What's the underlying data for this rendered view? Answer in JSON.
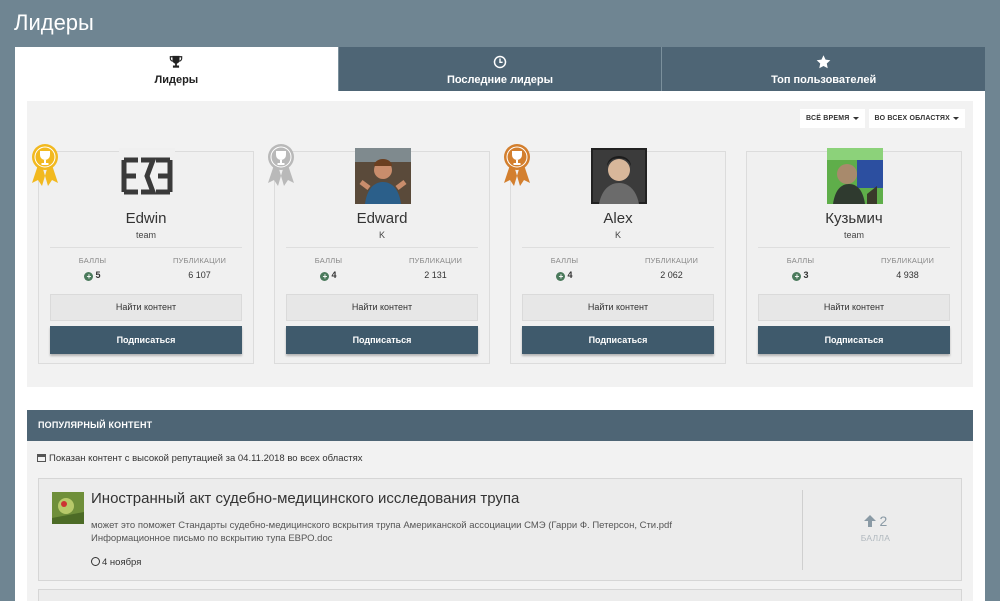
{
  "page_title": "Лидеры",
  "tabs": [
    {
      "label": "Лидеры",
      "icon": "trophy-icon",
      "active": true
    },
    {
      "label": "Последние лидеры",
      "icon": "clock-icon",
      "active": false
    },
    {
      "label": "Топ пользователей",
      "icon": "star-icon",
      "active": false
    }
  ],
  "filters": {
    "time": "ВСЁ ВРЕМЯ",
    "areas": "ВО ВСЕХ ОБЛАСТЯХ"
  },
  "leaders": [
    {
      "name": "Edwin",
      "group": "team",
      "points_label": "БАЛЛЫ",
      "points": "5",
      "posts_label": "ПУБЛИКАЦИИ",
      "posts": "6 107",
      "find_label": "Найти контент",
      "follow_label": "Подписаться",
      "rank": "gold"
    },
    {
      "name": "Edward",
      "group": "K",
      "points_label": "БАЛЛЫ",
      "points": "4",
      "posts_label": "ПУБЛИКАЦИИ",
      "posts": "2 131",
      "find_label": "Найти контент",
      "follow_label": "Подписаться",
      "rank": "silver"
    },
    {
      "name": "Alex",
      "group": "K",
      "points_label": "БАЛЛЫ",
      "points": "4",
      "posts_label": "ПУБЛИКАЦИИ",
      "posts": "2 062",
      "find_label": "Найти контент",
      "follow_label": "Подписаться",
      "rank": "bronze"
    },
    {
      "name": "Кузьмич",
      "group": "team",
      "points_label": "БАЛЛЫ",
      "points": "3",
      "posts_label": "ПУБЛИКАЦИИ",
      "posts": "4 938",
      "find_label": "Найти контент",
      "follow_label": "Подписаться",
      "rank": "none"
    }
  ],
  "popular": {
    "header": "ПОПУЛЯРНЫЙ КОНТЕНТ",
    "info": "Показан контент с высокой репутацией за 04.11.2018 во всех областях",
    "post": {
      "title": "Иностранный акт судебно-медицинского исследования трупа",
      "excerpt": "может это поможет Стандарты судебно-медицинского вскрытия трупа Американской ассоциации СМЭ (Гарри Ф. Петерсон, Сти.pdf Информационное письмо по вскрытию тупа ЕВРО.doc",
      "date": "4 ноября",
      "reputation": "2",
      "reputation_label": "БАЛЛА"
    }
  },
  "colors": {
    "accent": "#3f5a6c",
    "tab_bg": "#4e6575",
    "page_bg": "#6f8592",
    "gold": "#f2b91f",
    "silver": "#b9b9b9",
    "bronze": "#d37f2e",
    "positive": "#4b7a5c"
  }
}
